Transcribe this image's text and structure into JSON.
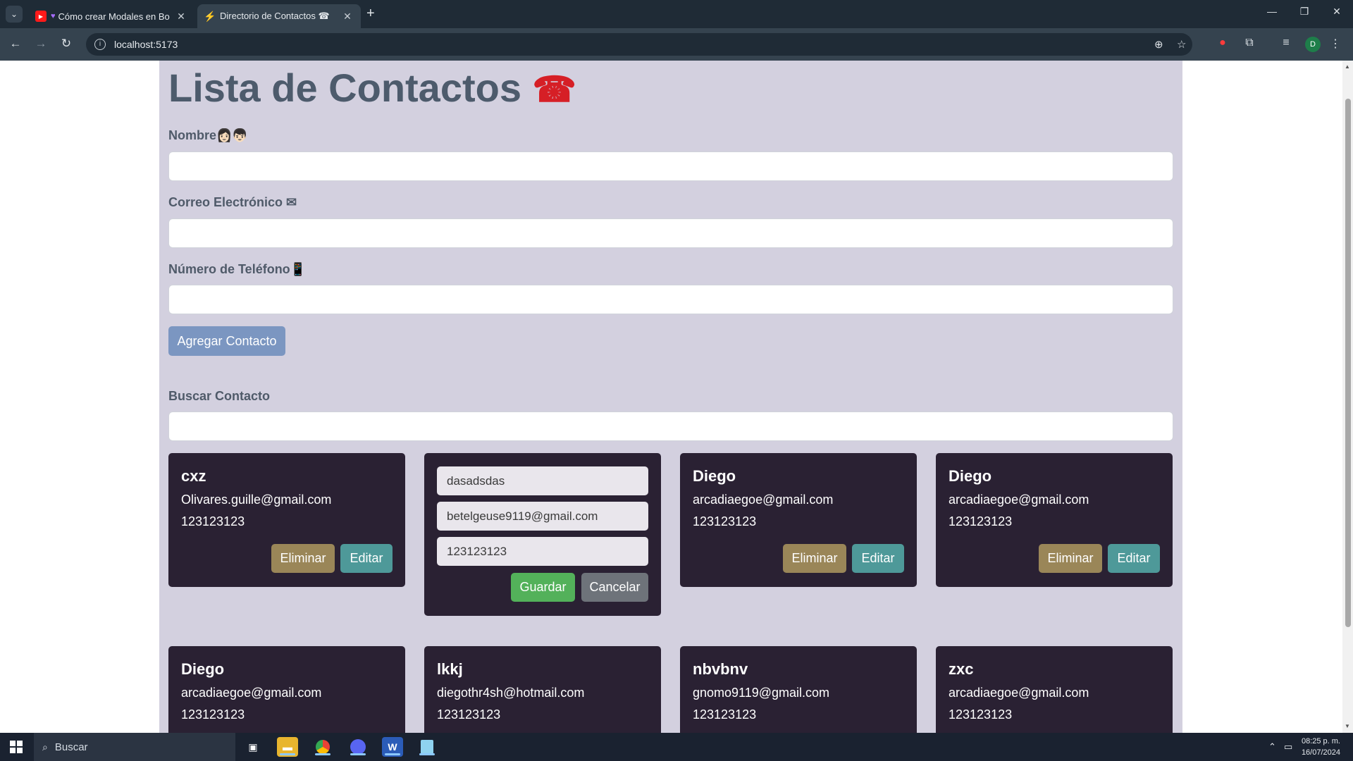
{
  "browser": {
    "tabs": [
      {
        "title": "Cómo crear Modales en Bo",
        "favicon": "youtube-icon",
        "active": false
      },
      {
        "title": "Directorio de Contactos ☎",
        "favicon": "vite-icon",
        "active": true
      }
    ],
    "url": "localhost:5173",
    "profile_initial": "D"
  },
  "page": {
    "title": "Lista de Contactos",
    "title_emoji": "☎",
    "form": {
      "name_label": "Nombre👩🏻👦🏻",
      "email_label": "Correo Electrónico ✉",
      "phone_label": "Número de Teléfono📱",
      "name_value": "",
      "email_value": "",
      "phone_value": "",
      "add_button": "Agregar Contacto"
    },
    "search": {
      "label": "Buscar Contacto",
      "value": ""
    },
    "buttons": {
      "delete": "Eliminar",
      "edit": "Editar",
      "save": "Guardar",
      "cancel": "Cancelar"
    },
    "contacts": [
      {
        "name": "cxz",
        "email": "Olivares.guille@gmail.com",
        "phone": "123123123"
      },
      {
        "name": "dasadsdas",
        "email": "betelgeuse9119@gmail.com",
        "phone": "123123123",
        "editing": true
      },
      {
        "name": "Diego",
        "email": "arcadiaegoe@gmail.com",
        "phone": "123123123"
      },
      {
        "name": "Diego",
        "email": "arcadiaegoe@gmail.com",
        "phone": "123123123"
      },
      {
        "name": "Diego",
        "email": "arcadiaegoe@gmail.com",
        "phone": "123123123"
      },
      {
        "name": "lkkj",
        "email": "diegothr4sh@hotmail.com",
        "phone": "123123123"
      },
      {
        "name": "nbvbnv",
        "email": "gnomo9119@gmail.com",
        "phone": "123123123"
      },
      {
        "name": "zxc",
        "email": "arcadiaegoe@gmail.com",
        "phone": "123123123"
      }
    ]
  },
  "taskbar": {
    "search_placeholder": "Buscar",
    "time": "08:25 p. m.",
    "date": "16/07/2024"
  },
  "colors": {
    "page_bg": "#d3d0df",
    "card_bg": "#2a2133",
    "title": "#4d5b6c",
    "add_button": "#7b96c1",
    "delete_button": "#9a8658",
    "edit_button": "#4e9999",
    "save_button": "#53b15a",
    "cancel_button": "#6e737a"
  }
}
